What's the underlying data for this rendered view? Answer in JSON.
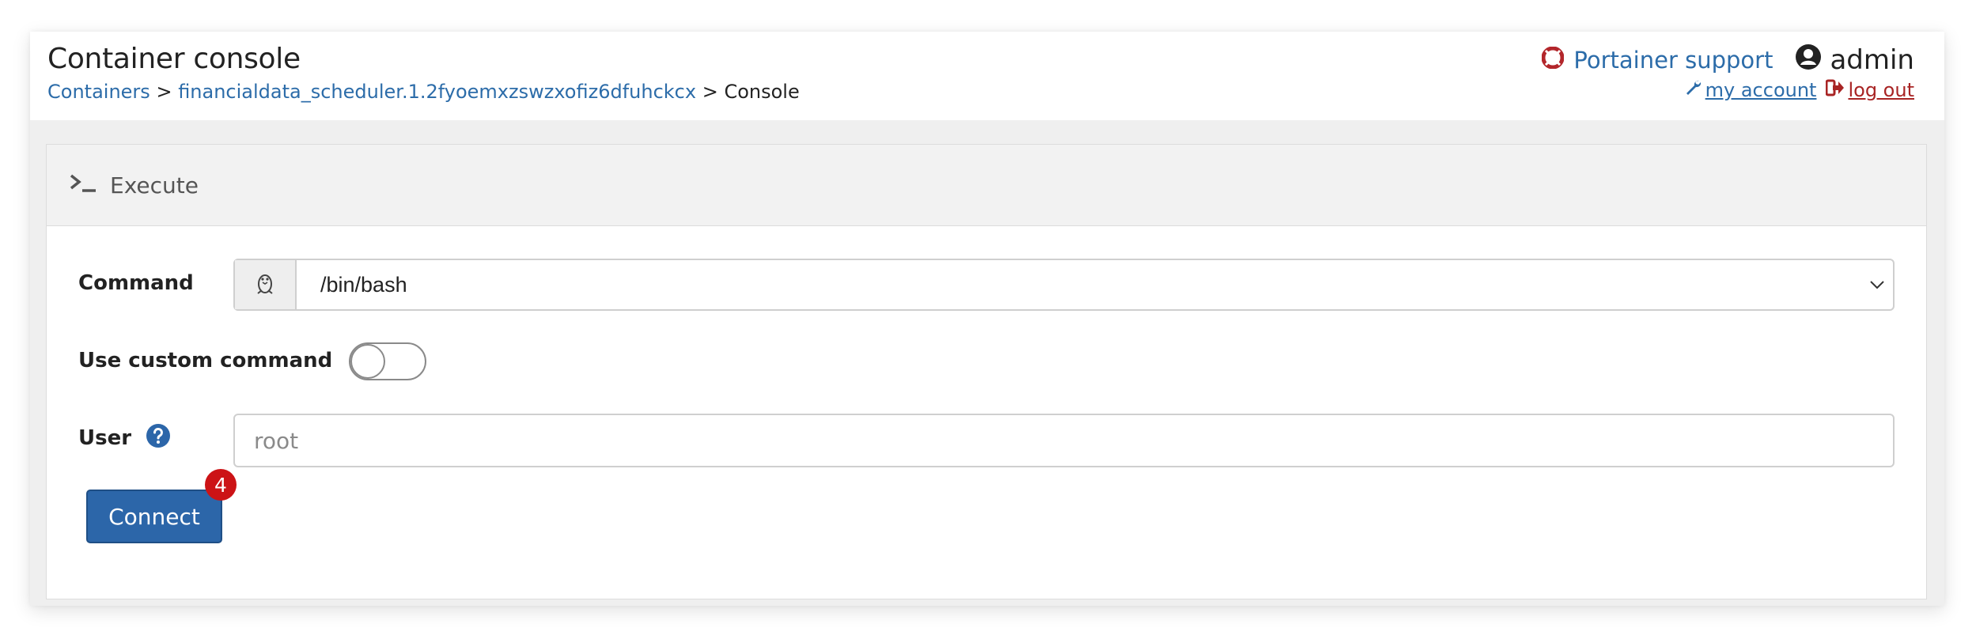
{
  "header": {
    "title": "Container console",
    "breadcrumb": {
      "containers": "Containers",
      "separator1": ">",
      "container_name": "financialdata_scheduler.1.2fyoemxzswzxofiz6dfuhckcx",
      "separator2": ">",
      "current": "Console"
    },
    "support_label": "Portainer support",
    "user_name": "admin",
    "my_account_label": "my account",
    "logout_label": "log out"
  },
  "widget": {
    "title": "Execute",
    "command_label": "Command",
    "command_value": "/bin/bash",
    "custom_command_label": "Use custom command",
    "custom_command_enabled": false,
    "user_label": "User",
    "user_placeholder": "root",
    "user_value": "",
    "connect_label": "Connect",
    "connect_badge": "4"
  },
  "icons": {
    "support": "life-ring-icon",
    "user": "user-circle-icon",
    "account": "wrench-icon",
    "logout": "sign-out-icon",
    "execute": "terminal-icon",
    "command_addon": "linux-icon",
    "help": "question-circle-icon",
    "dropdown": "chevron-down-icon"
  },
  "colors": {
    "link": "#2c6ca9",
    "danger": "#a82424",
    "primary_button": "#2c66a9",
    "badge": "#cc1316"
  }
}
